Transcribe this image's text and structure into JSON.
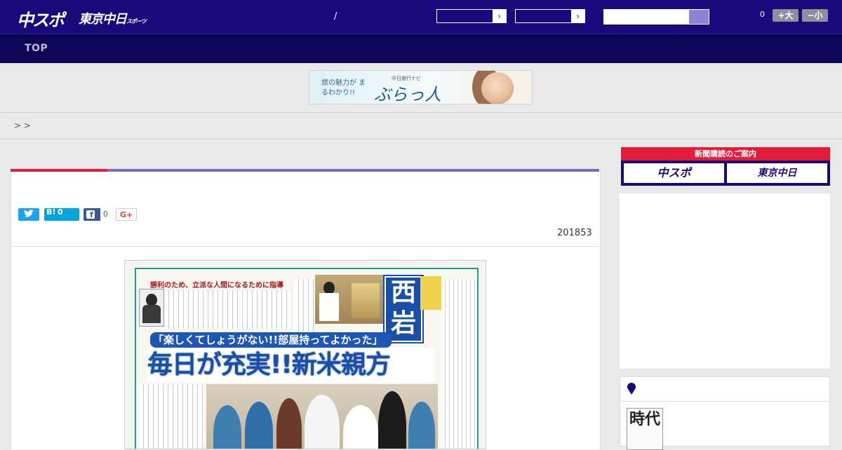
{
  "header": {
    "logo_chuspo": "中スポ",
    "logo_tokyo": "東京中日",
    "logo_tokyo_small": "スポーツ",
    "separator": "/",
    "select_arrow": "›",
    "font_count": "0",
    "font_larger": "+大",
    "font_smaller": "−小"
  },
  "nav": {
    "top": "TOP"
  },
  "banner": {
    "tagline": "旅の魅力が まるわかり!!",
    "brand_small": "中日旅行ナビ",
    "brand": "ぶらっ人"
  },
  "breadcrumb": {
    "text": ">  >"
  },
  "article": {
    "date": "201853",
    "share": {
      "twitter_icon": "bird-icon",
      "hatena_label": "B!",
      "hatena_count": "0",
      "facebook_count": "0",
      "gplus_label": "G+"
    },
    "newspaper": {
      "kicker": "勝利のため、立派な人間になるために指導",
      "name": "西岩",
      "subhead": "「楽しくてしょうがない!!部屋持ってよかった」",
      "headline": "毎日が充実!!新米親方"
    }
  },
  "sidebar": {
    "subscribe_title": "新聞購読のご案内",
    "subscribe_chuspo": "中スポ",
    "subscribe_tokyo": "東京中日",
    "ranking_icon": "medal-icon",
    "ranking_thumb_text": "時代"
  },
  "colors": {
    "header_bg": "#180a7c",
    "nav_bg": "#0d0555",
    "accent_red": "#e51b3a",
    "accent_purple": "#7a6ac4",
    "twitter": "#1da1f2",
    "hatena": "#00a4de",
    "facebook": "#3b5998"
  }
}
